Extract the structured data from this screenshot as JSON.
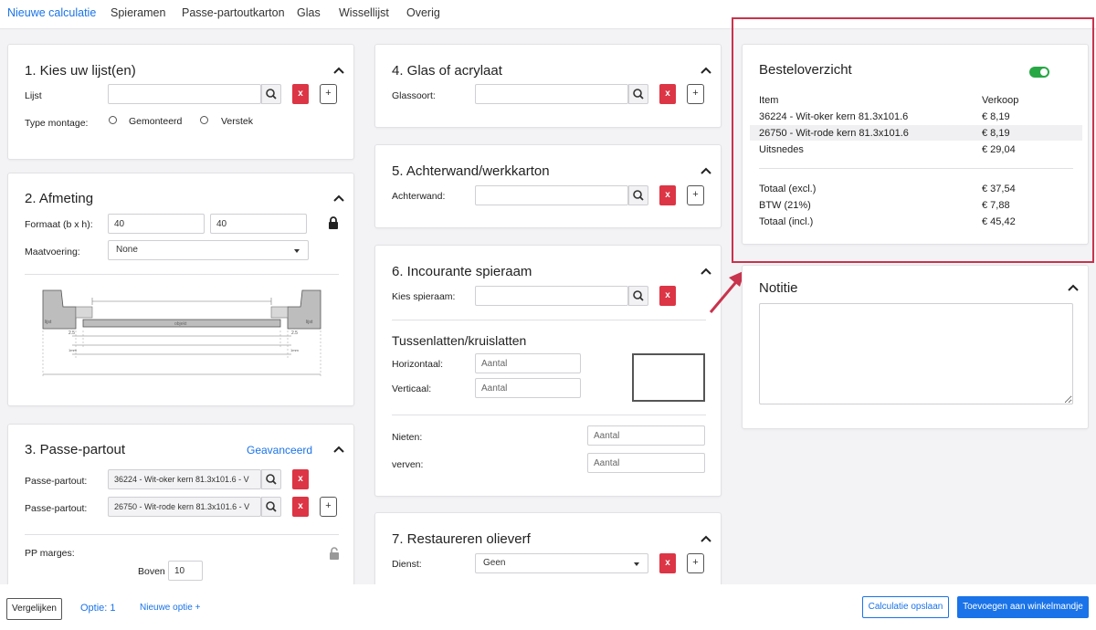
{
  "nav": {
    "tabs": [
      {
        "label": "Nieuwe calculatie"
      },
      {
        "label": "Spieramen"
      },
      {
        "label": "Passe-partoutkarton"
      },
      {
        "label": "Glas"
      },
      {
        "label": "Wissellijst"
      },
      {
        "label": "Overig"
      }
    ]
  },
  "colors": {
    "accent": "#1a73e8",
    "danger": "#dc3545",
    "toggle": "#28a745",
    "highlight": "#c8334d"
  },
  "card1": {
    "title": "1. Kies uw lijst(en)",
    "lijst_label": "Lijst",
    "lijst_value": "",
    "type_montage_label": "Type montage:",
    "option_gemonteerd": "Gemonteerd",
    "option_verstek": "Verstek",
    "x_label": "x",
    "plus_label": "+"
  },
  "card2": {
    "title": "2. Afmeting",
    "formaat_label": "Formaat (b x h):",
    "width_value": "40",
    "height_value": "40",
    "maatvoering_label": "Maatvoering:",
    "maatvoering_value": "None",
    "diagram": {
      "lijst_left": "lijst",
      "lijst_right": "lijst",
      "center": "objekt",
      "dim_left": "2.5",
      "dim_right": "2.5",
      "mm_left": "1mm",
      "mm_right": "1mm"
    }
  },
  "card3": {
    "title": "3. Passe-partout",
    "advanced_link": "Geavanceerd",
    "pp1_label": "Passe-partout:",
    "pp1_value": "36224 - Wit-oker kern 81.3x101.6 - V",
    "pp2_label": "Passe-partout:",
    "pp2_value": "26750 - Wit-rode kern 81.3x101.6 - V",
    "margins_label": "PP marges:",
    "boven_label": "Boven",
    "boven_value": "10",
    "x_label": "x",
    "plus_label": "+"
  },
  "card4": {
    "title": "4. Glas of acrylaat",
    "glassoort_label": "Glassoort:",
    "glassoort_value": "",
    "x_label": "x",
    "plus_label": "+"
  },
  "card5": {
    "title": "5. Achterwand/werkkarton",
    "achterwand_label": "Achterwand:",
    "achterwand_value": "",
    "x_label": "x",
    "plus_label": "+"
  },
  "card6": {
    "title": "6. Incourante spieraam",
    "kies_label": "Kies spieraam:",
    "kies_value": "",
    "subtitle": "Tussenlatten/kruislatten",
    "horizontaal_label": "Horizontaal:",
    "verticaal_label": "Verticaal:",
    "nieten_label": "Nieten:",
    "verven_label": "verven:",
    "aantal_placeholder": "Aantal",
    "x_label": "x"
  },
  "card7": {
    "title": "7. Restaureren olieverf",
    "dienst_label": "Dienst:",
    "dienst_value": "Geen",
    "x_label": "x",
    "plus_label": "+"
  },
  "summary": {
    "title": "Besteloverzicht",
    "toggle_on": true,
    "col_item": "Item",
    "col_verkoop": "Verkoop",
    "rows": [
      {
        "item": "36224 - Wit-oker kern 81.3x101.6",
        "price": "€ 8,19"
      },
      {
        "item": "26750 - Wit-rode kern 81.3x101.6",
        "price": "€ 8,19"
      },
      {
        "item": "Uitsnedes",
        "price": "€ 29,04"
      }
    ],
    "totals": [
      {
        "label": "Totaal (excl.)",
        "price": "€ 37,54"
      },
      {
        "label": "BTW (21%)",
        "price": "€ 7,88"
      },
      {
        "label": "Totaal (incl.)",
        "price": "€ 45,42"
      }
    ]
  },
  "notitie": {
    "title": "Notitie",
    "value": ""
  },
  "bottom": {
    "vergelijken": "Vergelijken",
    "optie": "Optie: 1",
    "nieuwe_optie": "Nieuwe optie +",
    "opslaan": "Calculatie opslaan",
    "winkelmandje": "Toevoegen aan winkelmandje"
  }
}
